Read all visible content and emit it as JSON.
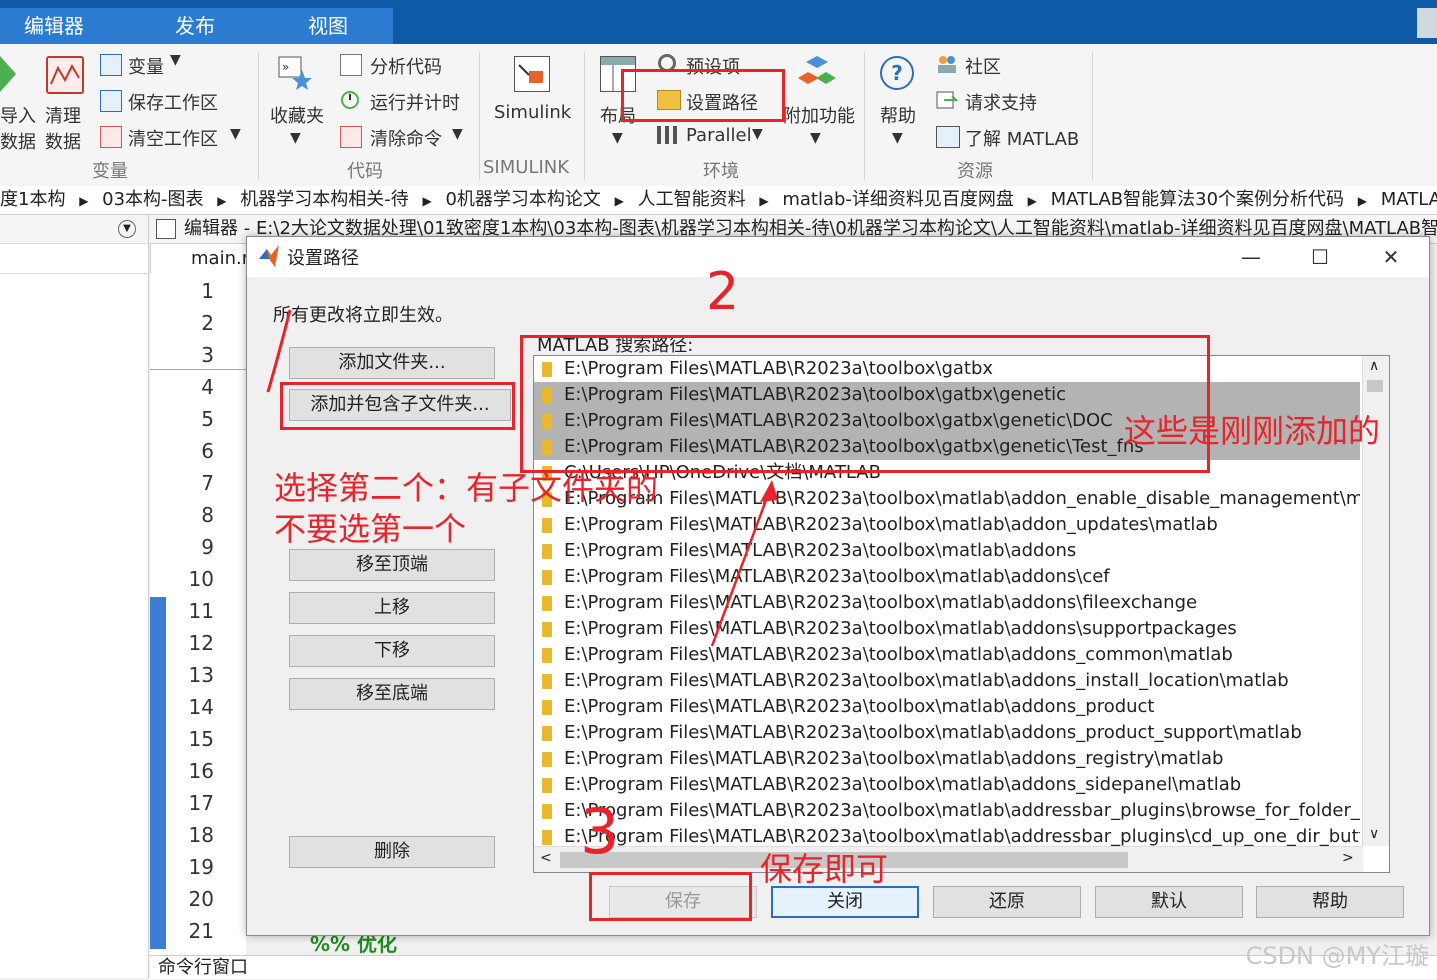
{
  "tabs": [
    "编辑器",
    "发布",
    "视图"
  ],
  "ribbon": {
    "import_label_1": "导入",
    "import_label_2": "数据",
    "clean_label_1": "清理",
    "clean_label_2": "数据",
    "variable": "变量",
    "save_workspace": "保存工作区",
    "clear_workspace": "清空工作区",
    "group_variable": "变量",
    "favorites": "收藏夹",
    "analyze_code": "分析代码",
    "run_time": "运行并计时",
    "clear_commands": "清除命令",
    "group_code": "代码",
    "simulink": "Simulink",
    "group_simulink": "SIMULINK",
    "layout": "布局",
    "preferences": "预设项",
    "set_path": "设置路径",
    "parallel": "Parallel",
    "addons": "附加功能",
    "group_env": "环境",
    "help": "帮助",
    "community": "社区",
    "request_support": "请求支持",
    "learn_matlab": "了解 MATLAB",
    "group_resources": "资源"
  },
  "breadcrumb": [
    "度1本构",
    "03本构-图表",
    "机器学习本构相关-待",
    "0机器学习本构论文",
    "人工智能资料",
    "matlab-详细资料见百度网盘",
    "MATLAB智能算法30个案例分析代码",
    "MATLAB智能"
  ],
  "editor": {
    "title": "编辑器 - E:\\2大论文数据处理\\01致密度1本构\\03本构-图表\\机器学习本构相关-待\\0机器学习本构论文\\人工智能资料\\matlab-详细资料见百度网盘\\MATLAB智",
    "tab": "main.m",
    "line_numbers": [
      "1",
      "2",
      "3",
      "4",
      "5",
      "6",
      "7",
      "8",
      "9",
      "10",
      "11",
      "12",
      "13",
      "14",
      "15",
      "16",
      "17",
      "18",
      "19",
      "20",
      "21"
    ],
    "code_fragment": "%% 优化",
    "command_window": "命令行窗口"
  },
  "dialog": {
    "title": "设置路径",
    "note": "所有更改将立即生效。",
    "btn_add_folder": "添加文件夹...",
    "btn_add_subfolders": "添加并包含子文件夹...",
    "btn_move_top": "移至顶端",
    "btn_move_up": "上移",
    "btn_move_down": "下移",
    "btn_move_bottom": "移至底端",
    "btn_remove": "删除",
    "list_label": "MATLAB 搜索路径:",
    "paths": [
      "E:\\Program Files\\MATLAB\\R2023a\\toolbox\\gatbx",
      "E:\\Program Files\\MATLAB\\R2023a\\toolbox\\gatbx\\genetic",
      "E:\\Program Files\\MATLAB\\R2023a\\toolbox\\gatbx\\genetic\\DOC",
      "E:\\Program Files\\MATLAB\\R2023a\\toolbox\\gatbx\\genetic\\Test_fns",
      "C:\\Users\\HP\\OneDrive\\文档\\MATLAB",
      "E:\\Program Files\\MATLAB\\R2023a\\toolbox\\matlab\\addon_enable_disable_management\\mat",
      "E:\\Program Files\\MATLAB\\R2023a\\toolbox\\matlab\\addon_updates\\matlab",
      "E:\\Program Files\\MATLAB\\R2023a\\toolbox\\matlab\\addons",
      "E:\\Program Files\\MATLAB\\R2023a\\toolbox\\matlab\\addons\\cef",
      "E:\\Program Files\\MATLAB\\R2023a\\toolbox\\matlab\\addons\\fileexchange",
      "E:\\Program Files\\MATLAB\\R2023a\\toolbox\\matlab\\addons\\supportpackages",
      "E:\\Program Files\\MATLAB\\R2023a\\toolbox\\matlab\\addons_common\\matlab",
      "E:\\Program Files\\MATLAB\\R2023a\\toolbox\\matlab\\addons_install_location\\matlab",
      "E:\\Program Files\\MATLAB\\R2023a\\toolbox\\matlab\\addons_product",
      "E:\\Program Files\\MATLAB\\R2023a\\toolbox\\matlab\\addons_product_support\\matlab",
      "E:\\Program Files\\MATLAB\\R2023a\\toolbox\\matlab\\addons_registry\\matlab",
      "E:\\Program Files\\MATLAB\\R2023a\\toolbox\\matlab\\addons_sidepanel\\matlab",
      "E:\\Program Files\\MATLAB\\R2023a\\toolbox\\matlab\\addressbar_plugins\\browse_for_folder_bu",
      "E:\\Program Files\\MATLAB\\R2023a\\toolbox\\matlab\\addressbar_plugins\\cd_up_one_dir_butto"
    ],
    "selected_rows": [
      1,
      2,
      3
    ],
    "btn_save": "保存",
    "btn_close": "关闭",
    "btn_revert": "还原",
    "btn_default": "默认",
    "btn_help": "帮助"
  },
  "annotations": {
    "num2": "2",
    "num3": "3",
    "added_note": "这些是刚刚添加的",
    "choose_line1": "选择第二个：有子文件夹的",
    "choose_line2": "不要选第一个",
    "save_note": "保存即可"
  },
  "watermark": "CSDN @MY江璇",
  "colors": {
    "annotation_red": "#e8232a",
    "tab_blue": "#0e5aa7",
    "selection_gray": "#b3b3b3"
  }
}
